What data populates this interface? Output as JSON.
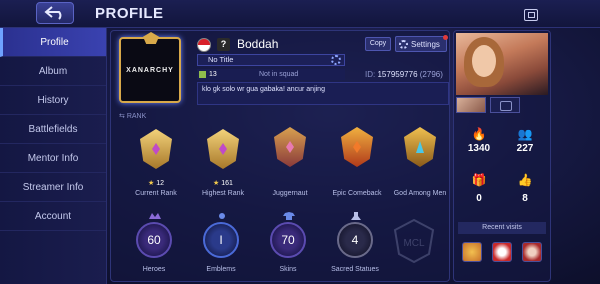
{
  "header": {
    "title": "PROFILE"
  },
  "sidebar": {
    "items": [
      {
        "label": "Profile",
        "active": true
      },
      {
        "label": "Album"
      },
      {
        "label": "History"
      },
      {
        "label": "Battlefields"
      },
      {
        "label": "Mentor Info"
      },
      {
        "label": "Streamer Info"
      },
      {
        "label": "Account"
      }
    ]
  },
  "profile": {
    "avatar_text": "XANARCHY",
    "name": "Boddah",
    "copy_label": "Copy",
    "settings_label": "Settings",
    "title": "No Title",
    "level": "13",
    "squad": "Not in squad",
    "id_label": "ID:",
    "id": "157959776",
    "server": "(2796)",
    "bio": "klo gk solo wr gua gabaka! ancur anjing"
  },
  "rank": {
    "label": "RANK",
    "items": [
      {
        "caption": "Current Rank",
        "stars": "12"
      },
      {
        "caption": "Highest Rank",
        "stars": "161"
      },
      {
        "caption": "Juggernaut"
      },
      {
        "caption": "Epic Comeback"
      },
      {
        "caption": "God Among Men"
      }
    ]
  },
  "stats": [
    {
      "caption": "Heroes",
      "value": "60"
    },
    {
      "caption": "Emblems",
      "value": "I"
    },
    {
      "caption": "Skins",
      "value": "70"
    },
    {
      "caption": "Sacred Statues",
      "value": "4"
    }
  ],
  "social": {
    "likes": "1340",
    "followers": "227",
    "gifts": "0",
    "thumbs": "8",
    "recent_visits_label": "Recent visits"
  },
  "colors": {
    "accent": "#3a42b0",
    "gold": "#d8a94a",
    "notification": "#e13a3a"
  }
}
